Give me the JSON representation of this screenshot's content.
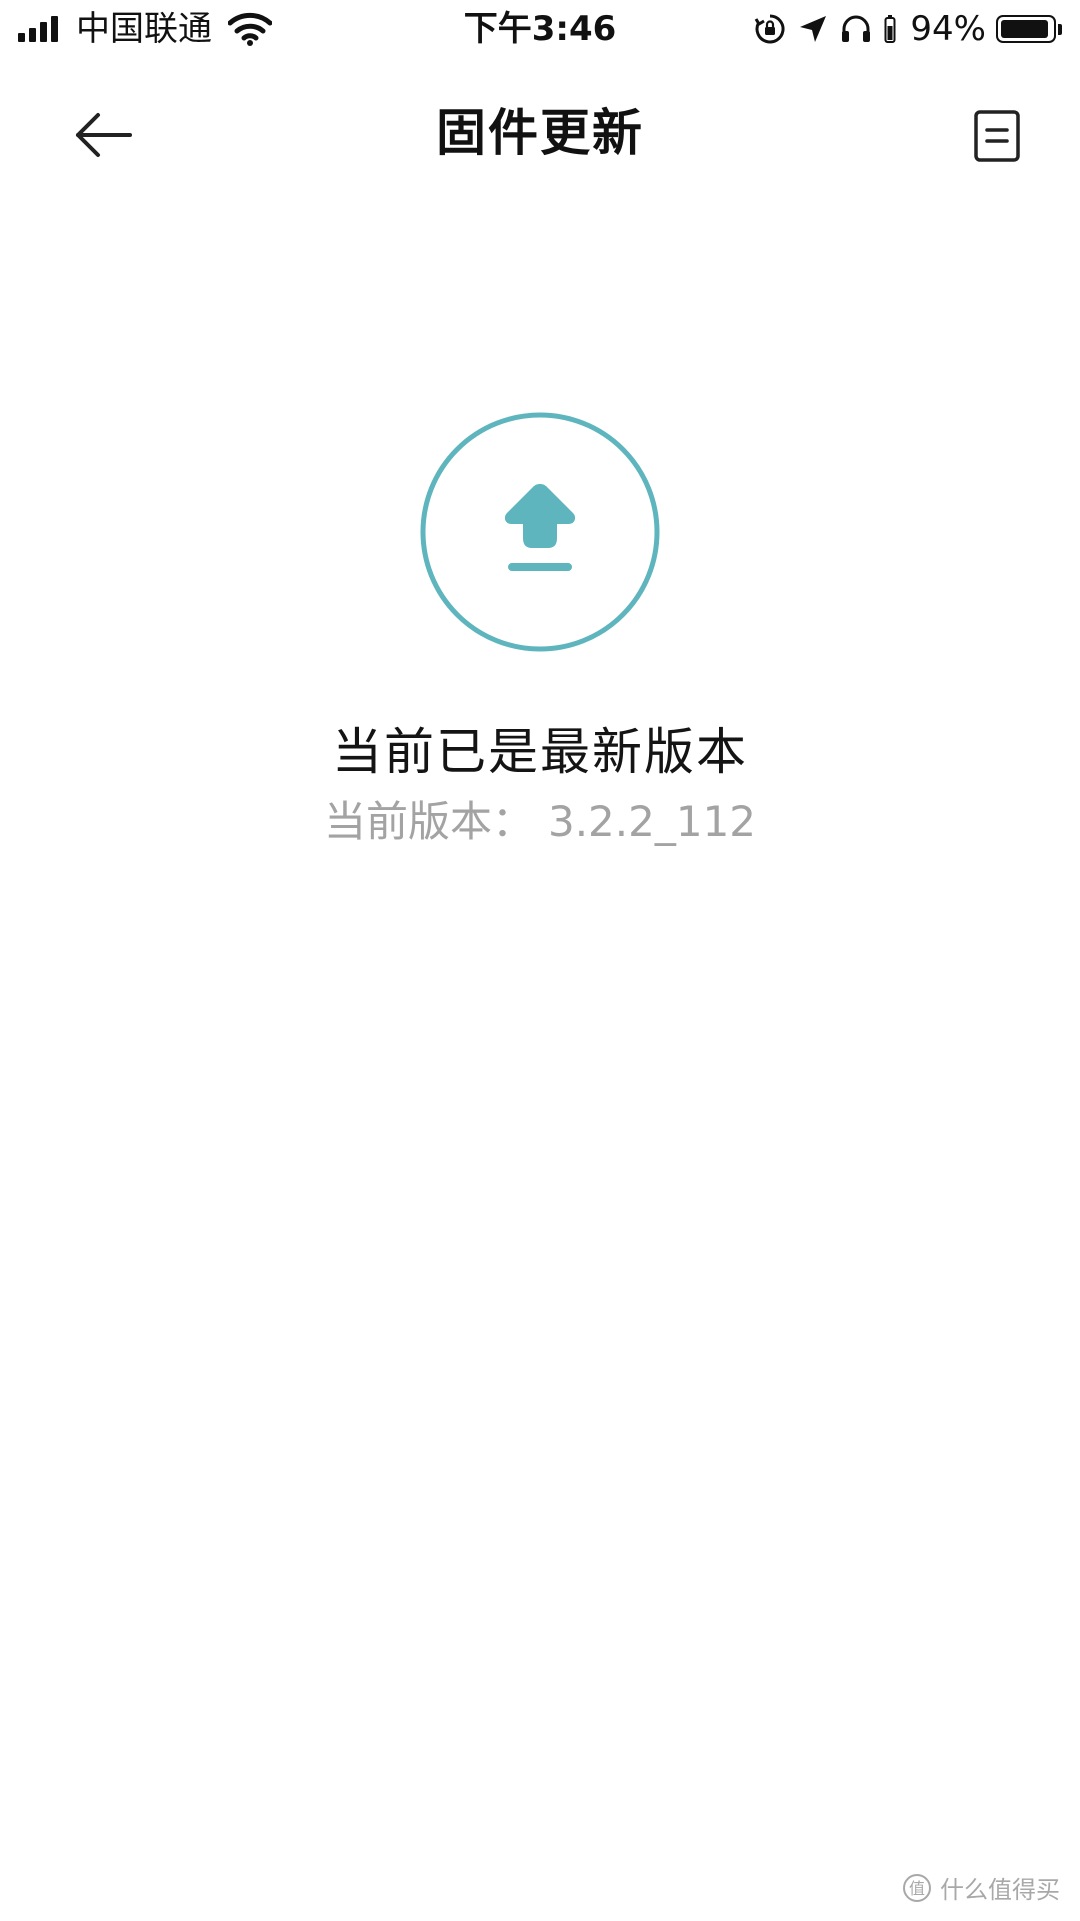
{
  "status_bar": {
    "carrier": "中国联通",
    "time": "下午3:46",
    "battery_percent": "94%",
    "battery_level": 0.94,
    "icons": [
      "signal-bars-icon",
      "wifi-icon",
      "rotation-lock-icon",
      "location-arrow-icon",
      "headphones-icon",
      "battery-icon"
    ]
  },
  "nav": {
    "title": "固件更新",
    "back_icon": "arrow-left-icon",
    "log_icon": "document-icon"
  },
  "main": {
    "icon": "upload-arrow-icon",
    "status_text": "当前已是最新版本",
    "version_label": "当前版本：",
    "version_value": "3.2.2_112"
  },
  "watermark": {
    "text": "什么值得买",
    "icon": "smzdm-logo-icon"
  },
  "colors": {
    "accent": "#5fb5bd",
    "text_primary": "#141414",
    "text_secondary": "#a3a3a3",
    "background": "#ffffff"
  }
}
